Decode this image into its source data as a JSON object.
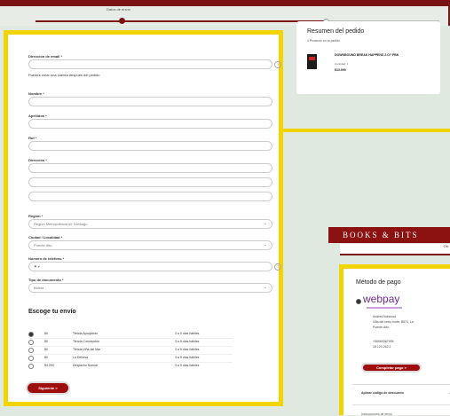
{
  "stepper": {
    "label": "Datos de envío"
  },
  "form": {
    "email_label": "Dirección de email *",
    "email_hint": "Puedes crear una cuenta después del pedido",
    "email_help": "?",
    "nombre_label": "Nombre *",
    "apellidos_label": "Apellidos *",
    "rut_label": "Rut *",
    "direccion_label": "Dirección *",
    "region_label": "Región *",
    "region_value": "Región Metropolitana de Santiago",
    "ciudad_label": "Ciudad / Localidad *",
    "ciudad_value": "Puente Alto",
    "telefono_label": "Número de teléfono *",
    "telefono_prefix": "⚑ ▾",
    "telefono_help": "?",
    "documento_label": "Tipo de documento *",
    "documento_value": "Boleta",
    "chevron": "⌄"
  },
  "shipping": {
    "title": "Escoge tu envío",
    "options": [
      {
        "price": "$0",
        "store": "Tienda Apoquindo",
        "eta": "3 a 5 días hábiles",
        "selected": true
      },
      {
        "price": "$0",
        "store": "Tienda Concepción",
        "eta": "3 a 5 días hábiles",
        "selected": false
      },
      {
        "price": "$0",
        "store": "Tienda Viña del Mar",
        "eta": "3 a 5 días hábiles",
        "selected": false
      },
      {
        "price": "$0",
        "store": "La Dehesa",
        "eta": "3 a 5 días hábiles",
        "selected": false
      },
      {
        "price": "$4.290",
        "store": "Despacho Normal",
        "eta": "3 a 5 días hábiles",
        "selected": false
      }
    ],
    "next_button": "Siguiente >"
  },
  "summary": {
    "title": "Resumen del pedido",
    "sub": "1 Producto en tu pedido",
    "product_name": "DOWNBOUND BREAK HAPPENS 2.O? PBK",
    "product_qty": "Cantidad: 1",
    "product_price": "$13.990"
  },
  "brand": {
    "name": "BOOKS & BITS",
    "sub": "Ob"
  },
  "payment": {
    "title": "Método de pago",
    "webpay": "webpay",
    "info_lines": [
      "Andrés Nohimod",
      "Villa del cerro norte, 8874, La",
      "Puente Alto,"
    ],
    "info_lines2": [
      "+56969367905",
      "18.120.262-1"
    ],
    "pay_button": "Completar pago >",
    "coupon": "Aplicar código de descuento",
    "coupon_chev": "⌄",
    "more": "Instrucciones de envío"
  },
  "colors": {
    "accent": "#a00d0d",
    "highlight": "#f2d400",
    "brand": "#8c1111"
  }
}
